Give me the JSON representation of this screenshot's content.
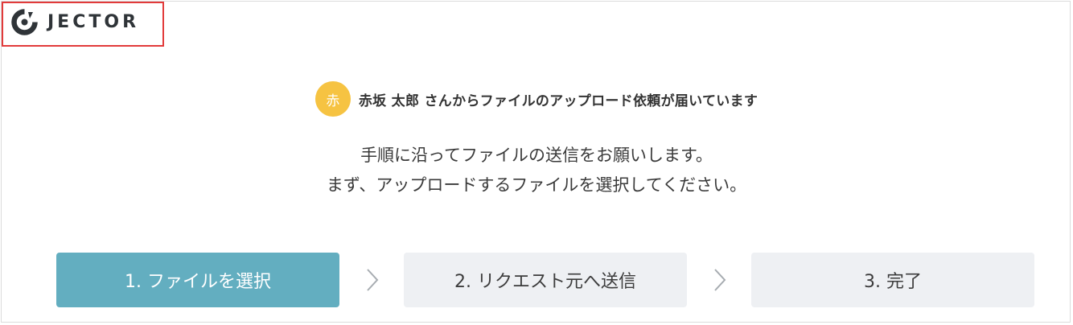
{
  "header": {
    "logo_text": "JECTOR",
    "logo_icon": "jector-logo-icon"
  },
  "request": {
    "avatar_initial": "赤",
    "message": "赤坂 太郎 さんからファイルのアップロード依頼が届いています",
    "avatar_color": "#f6c342"
  },
  "instructions": {
    "line1": "手順に沿ってファイルの送信をお願いします。",
    "line2": "まず、アップロードするファイルを選択してください。"
  },
  "steps": [
    {
      "label": "1. ファイルを選択",
      "state": "active"
    },
    {
      "label": "2. リクエスト元へ送信",
      "state": "inactive"
    },
    {
      "label": "3. 完了",
      "state": "inactive"
    }
  ],
  "colors": {
    "accent": "#63aec0",
    "inactive_step": "#eef0f3",
    "highlight_border": "#e23b3b"
  }
}
